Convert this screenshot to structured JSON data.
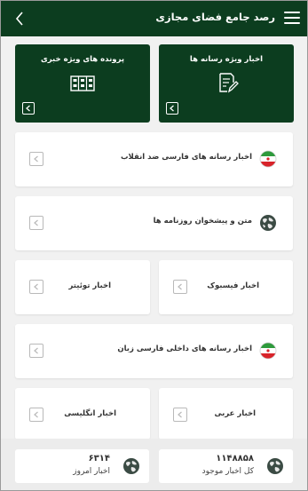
{
  "header": {
    "title": "رصد جامع فضای مجازی",
    "back_icon": "chevron-left-icon",
    "menu_icon": "hamburger-icon"
  },
  "tiles": [
    {
      "label": "اخبار ویژه رسانه ها",
      "icon": "edit-document-icon"
    },
    {
      "label": "پرونده های ویژه خبری",
      "icon": "folders-icon"
    }
  ],
  "cards": {
    "counter_revolution_media": "اخبار رسانه های فارسی ضد انقلاب",
    "newspapers": "متن و پیشخوان روزنامه ها",
    "facebook": "اخبار فیسبوک",
    "twitter": "اخبار توئیتر",
    "domestic_media": "اخبار رسانه های داخلی فارسی زبان",
    "arabic": "اخبار عربی",
    "english": "اخبار انگلیسی"
  },
  "stats": {
    "total": {
      "value": "۱۱۴۸۸۵۸",
      "label": "کل اخبار موجود"
    },
    "today": {
      "value": "۶۳۱۴",
      "label": "اخبار امروز"
    }
  },
  "colors": {
    "primary_dark": "#0c3d1f",
    "background": "#f1f1f1",
    "card": "#ffffff"
  }
}
